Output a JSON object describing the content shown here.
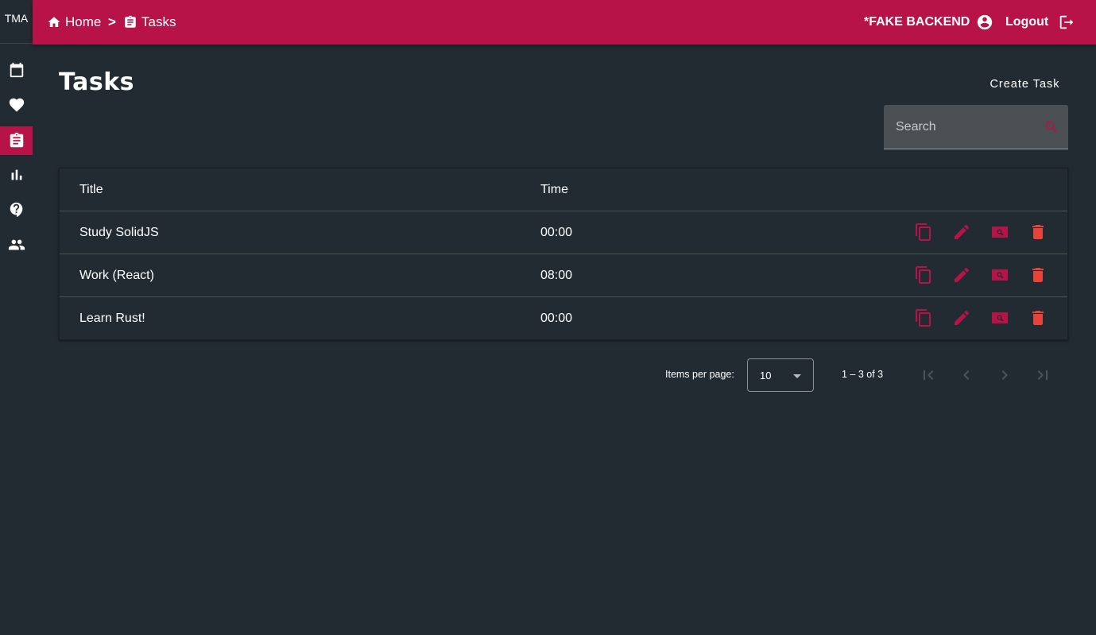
{
  "app": {
    "brand": "TMA"
  },
  "sidebar": {
    "items": [
      {
        "name": "calendar",
        "icon": "calendar-icon",
        "active": false
      },
      {
        "name": "favorites",
        "icon": "heart-icon",
        "active": false
      },
      {
        "name": "tasks",
        "icon": "clipboard-icon",
        "active": true
      },
      {
        "name": "stats",
        "icon": "bar-chart-icon",
        "active": false
      },
      {
        "name": "help",
        "icon": "help-icon",
        "active": false
      },
      {
        "name": "users",
        "icon": "people-icon",
        "active": false
      }
    ]
  },
  "header": {
    "breadcrumb": {
      "home": "Home",
      "separator": ">",
      "current": "Tasks"
    },
    "backend_label": "*FAKE BACKEND",
    "logout_label": "Logout"
  },
  "page": {
    "title": "Tasks",
    "create_label": "Create Task",
    "search": {
      "placeholder": "Search",
      "value": ""
    }
  },
  "table": {
    "columns": [
      "Title",
      "Time"
    ],
    "rows": [
      {
        "title": "Study SolidJS",
        "time": "00:00"
      },
      {
        "title": "Work (React)",
        "time": "08:00"
      },
      {
        "title": "Learn Rust!",
        "time": "00:00"
      }
    ],
    "actions": [
      "copy-icon",
      "edit-icon",
      "view-icon",
      "delete-icon"
    ]
  },
  "pagination": {
    "items_per_page_label": "Items per page:",
    "items_per_page": "10",
    "range": "1 – 3 of 3"
  },
  "colors": {
    "accent": "#b71349",
    "background": "#222b31",
    "delete": "#e8433a"
  }
}
